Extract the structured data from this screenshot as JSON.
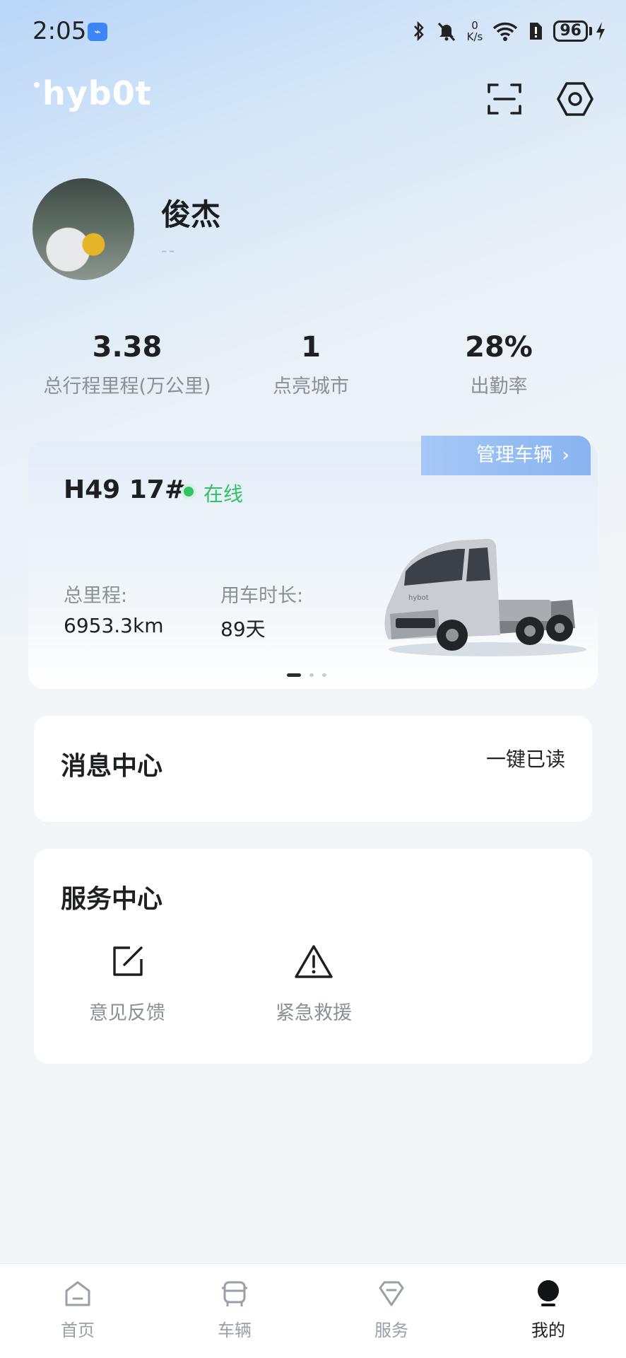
{
  "status_bar": {
    "time": "2:05",
    "net_speed_value": "0",
    "net_speed_unit": "K/s",
    "battery": "96"
  },
  "header": {
    "logo_text": "hybot"
  },
  "profile": {
    "name": "俊杰",
    "subtitle": "--"
  },
  "stats": [
    {
      "value": "3.38",
      "label": "总行程里程(万公里)"
    },
    {
      "value": "1",
      "label": "点亮城市"
    },
    {
      "value": "28%",
      "label": "出勤率"
    }
  ],
  "vehicle": {
    "plate": "H49 17#",
    "status": "在线",
    "manage_label": "管理车辆",
    "total_mileage_label": "总里程:",
    "total_mileage_value": "6953.3km",
    "usage_duration_label": "用车时长:",
    "usage_duration_value": "89天",
    "carousel_index": 1,
    "carousel_count": 3
  },
  "message_center": {
    "title": "消息中心",
    "mark_all_read": "一键已读"
  },
  "service_center": {
    "title": "服务中心",
    "items": [
      {
        "label": "意见反馈",
        "icon": "edit-icon"
      },
      {
        "label": "紧急救援",
        "icon": "warning-icon"
      }
    ]
  },
  "bottom_nav": {
    "items": [
      {
        "label": "首页",
        "icon": "home-icon"
      },
      {
        "label": "车辆",
        "icon": "vehicle-icon"
      },
      {
        "label": "服务",
        "icon": "diamond-icon"
      },
      {
        "label": "我的",
        "icon": "profile-icon"
      }
    ],
    "active": "我的"
  },
  "colors": {
    "online": "#32c264",
    "accent_tab": "#88b3f0"
  }
}
